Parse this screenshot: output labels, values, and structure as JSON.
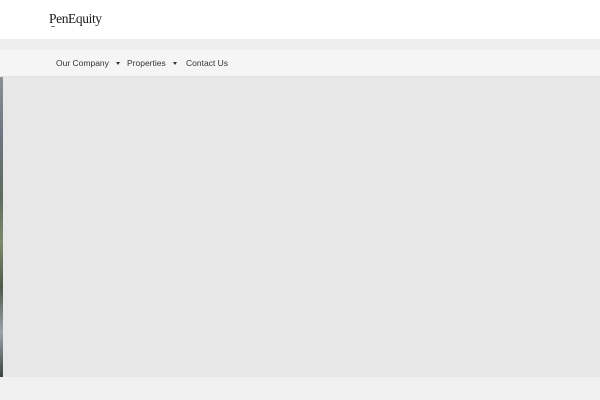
{
  "header": {
    "logo_text": "PenEquity"
  },
  "nav": {
    "items": [
      {
        "label": "Our Company",
        "has_dropdown": true
      },
      {
        "label": "Properties",
        "has_dropdown": true
      },
      {
        "label": "Contact Us",
        "has_dropdown": false
      }
    ]
  },
  "colors": {
    "header_bg": "#ffffff",
    "nav_bg": "#f5f5f5",
    "hero_bg": "#e7e7e7",
    "text": "#333333"
  }
}
